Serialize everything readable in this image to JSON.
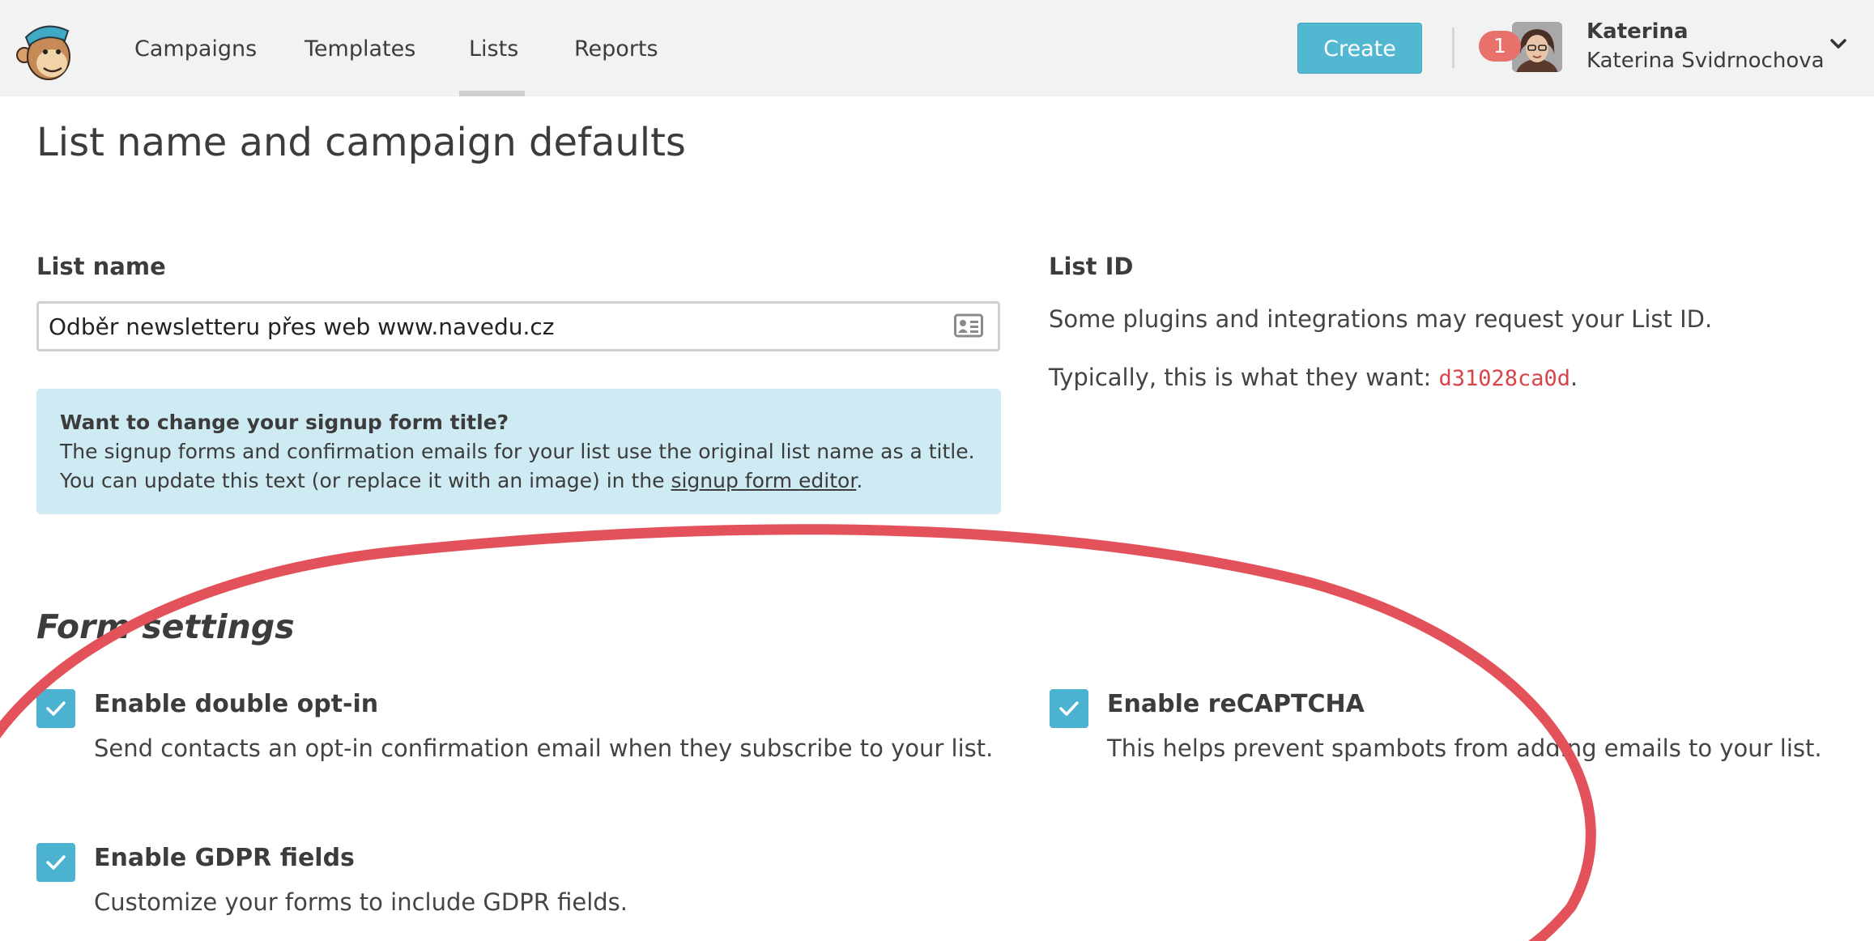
{
  "nav": {
    "items": [
      {
        "label": "Campaigns"
      },
      {
        "label": "Templates"
      },
      {
        "label": "Lists",
        "active": true
      },
      {
        "label": "Reports"
      }
    ],
    "create_label": "Create",
    "notification_count": "1",
    "user": {
      "first_name": "Katerina",
      "full_name": "Katerina Svidrnochova"
    }
  },
  "page": {
    "title": "List name and campaign defaults"
  },
  "list_name": {
    "label": "List name",
    "value": "Odběr newsletteru přes web www.navedu.cz"
  },
  "info_box": {
    "title": "Want to change your signup form title?",
    "line1": "The signup forms and confirmation emails for your list use the original list name as a title.",
    "line2_prefix": "You can update this text (or replace it with an image) in the ",
    "link": "signup form editor",
    "line2_suffix": "."
  },
  "list_id": {
    "label": "List ID",
    "line1": "Some plugins and integrations may request your List ID.",
    "line2_prefix": "Typically, this is what they want: ",
    "id": "d31028ca0d",
    "line2_suffix": "."
  },
  "form_settings": {
    "title": "Form settings",
    "options": [
      {
        "title": "Enable double opt-in",
        "desc": "Send contacts an opt-in confirmation email when they subscribe to your list.",
        "checked": true
      },
      {
        "title": "Enable reCAPTCHA",
        "desc": "This helps prevent spambots from adding emails to your list.",
        "checked": true
      },
      {
        "title": "Enable GDPR fields",
        "desc": "Customize your forms to include GDPR fields.",
        "checked": true
      }
    ]
  },
  "colors": {
    "accent": "#52b7d1",
    "checkbox": "#4bb3d1",
    "badge": "#e8716b",
    "annotation": "#e3525b",
    "info_bg": "#ceeaf2"
  },
  "icons": [
    "monkey-logo-icon",
    "user-avatar",
    "chevron-down-icon",
    "contact-card-icon",
    "checkmark-icon"
  ]
}
